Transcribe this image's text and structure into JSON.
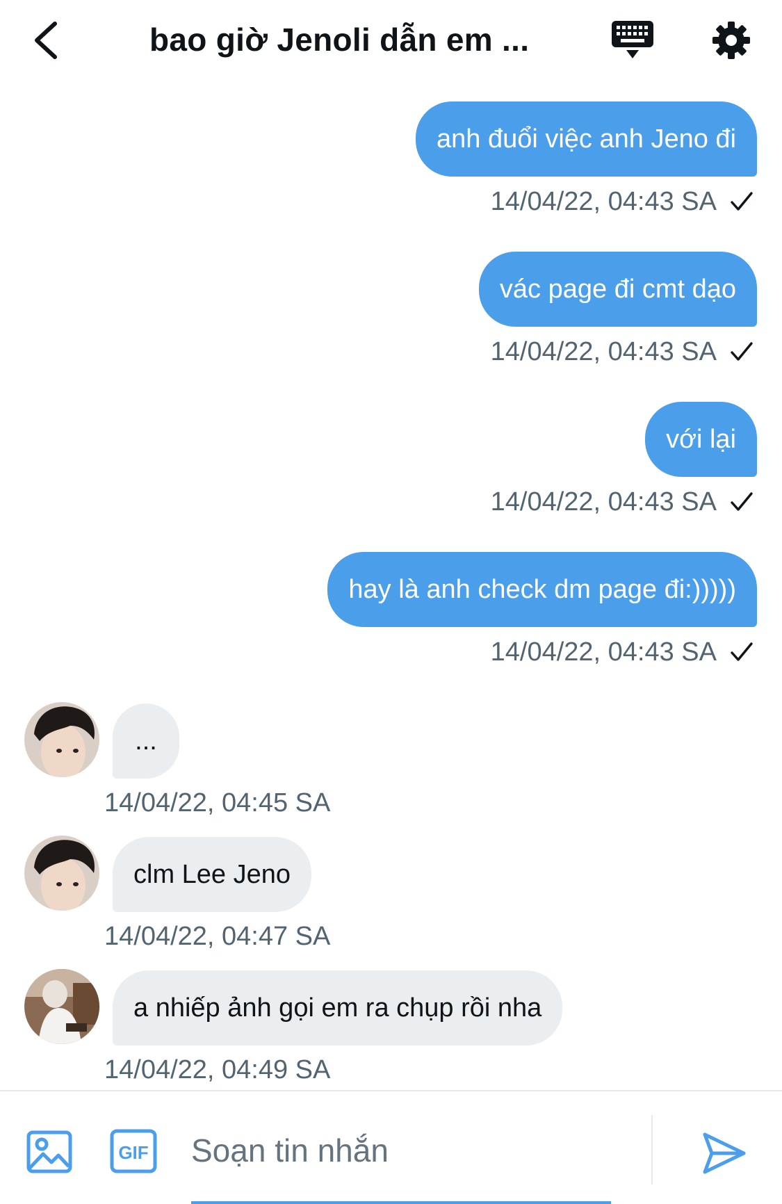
{
  "header": {
    "title": "bao giờ Jenoli dẫn em ...",
    "back_icon": "chevron-left-icon",
    "keyboard_icon": "keyboard-icon",
    "settings_icon": "gear-icon"
  },
  "messages": [
    {
      "direction": "sent",
      "text": "anh đuổi việc anh Jeno đi",
      "timestamp": "14/04/22, 04:43 SA",
      "status_icon": "check-icon"
    },
    {
      "direction": "sent",
      "text": "vác page đi cmt dạo",
      "timestamp": "14/04/22, 04:43 SA",
      "status_icon": "check-icon"
    },
    {
      "direction": "sent",
      "text": "với lại",
      "timestamp": "14/04/22, 04:43 SA",
      "status_icon": "check-icon"
    },
    {
      "direction": "sent",
      "text": "hay là anh check dm page đi:)))))",
      "timestamp": "14/04/22, 04:43 SA",
      "status_icon": "check-icon"
    },
    {
      "direction": "received",
      "text": "...",
      "timestamp": "14/04/22, 04:45 SA"
    },
    {
      "direction": "received",
      "text": "clm Lee Jeno",
      "timestamp": "14/04/22, 04:47 SA"
    },
    {
      "direction": "received",
      "text": "a nhiếp ảnh gọi em ra chụp rồi nha",
      "timestamp": "14/04/22, 04:49 SA"
    }
  ],
  "compose": {
    "placeholder": "Soạn tin nhắn",
    "value": "",
    "image_icon": "image-icon",
    "gif_label": "GIF",
    "send_icon": "send-icon"
  },
  "colors": {
    "accent": "#4a9eea",
    "received_bubble": "#ebeef0",
    "meta_text": "#536471"
  }
}
